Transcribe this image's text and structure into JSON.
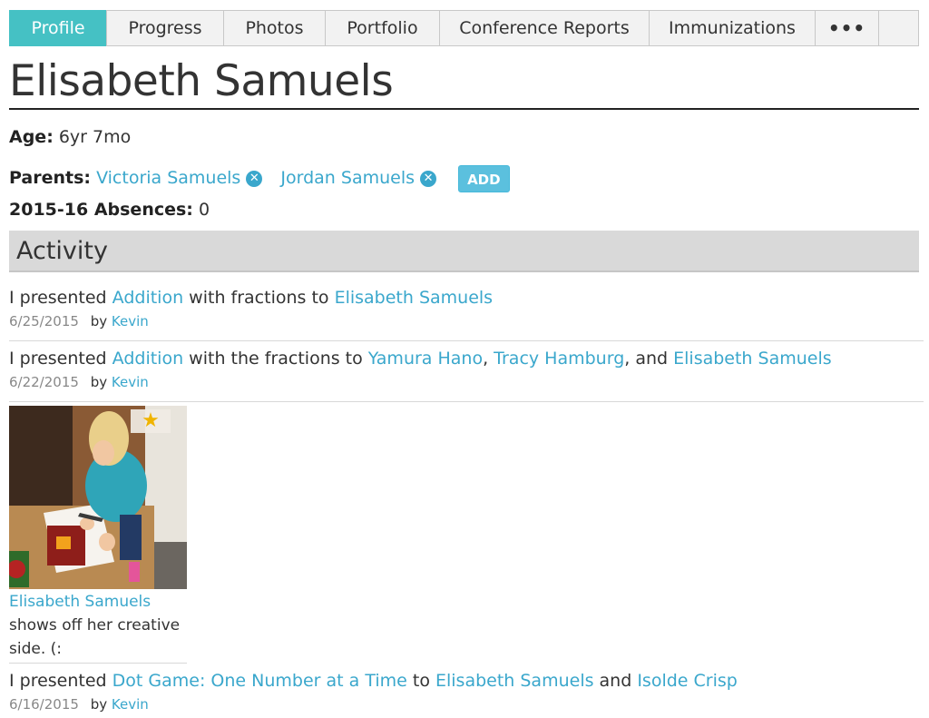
{
  "tabs": [
    {
      "label": "Profile",
      "active": true
    },
    {
      "label": "Progress"
    },
    {
      "label": "Photos"
    },
    {
      "label": "Portfolio"
    },
    {
      "label": "Conference Reports"
    },
    {
      "label": "Immunizations"
    },
    {
      "label": "•••"
    }
  ],
  "student": {
    "name": "Elisabeth Samuels",
    "age_label": "Age:",
    "age_value": "6yr 7mo",
    "parents_label": "Parents:",
    "parents": [
      "Victoria Samuels",
      "Jordan Samuels"
    ],
    "add_label": "ADD",
    "absences_label": "2015-16 Absences:",
    "absences_value": "0"
  },
  "activity": {
    "header": "Activity",
    "entries": [
      {
        "prefix": "I presented ",
        "lesson": "Addition",
        "middle": " with fractions to ",
        "students": [
          "Elisabeth Samuels"
        ],
        "date": "6/25/2015",
        "by_label": "by",
        "by": "Kevin"
      },
      {
        "prefix": "I presented ",
        "lesson": "Addition",
        "middle": " with the fractions to ",
        "students": [
          "Yamura Hano",
          "Tracy Hamburg",
          "Elisabeth Samuels"
        ],
        "sep1": ", ",
        "sep2": ", and ",
        "date": "6/22/2015",
        "by_label": "by",
        "by": "Kevin"
      },
      {
        "prefix": "I presented ",
        "lesson": "Dot Game: One Number at a Time",
        "middle": " to ",
        "students": [
          "Elisabeth Samuels",
          "Isolde Crisp"
        ],
        "sep1": " and ",
        "date": "6/16/2015",
        "by_label": "by",
        "by": "Kevin"
      }
    ],
    "photo": {
      "star": "★",
      "caption_name": "Elisabeth Samuels",
      "caption_text": "shows off her creative side. (:"
    }
  }
}
